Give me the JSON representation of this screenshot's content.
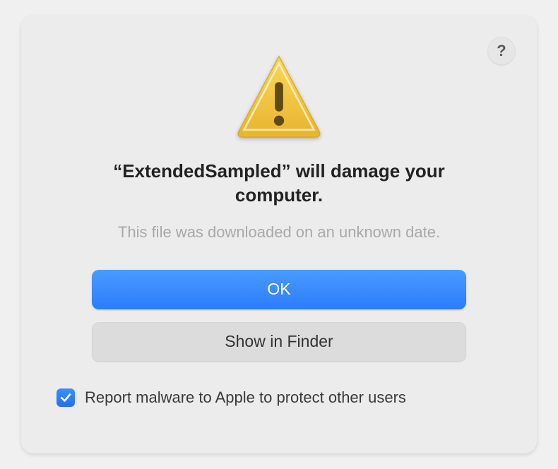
{
  "dialog": {
    "title": "“ExtendedSampled” will damage your computer.",
    "subtitle": "This file was downloaded on an unknown date.",
    "help_label": "?",
    "buttons": {
      "primary": "OK",
      "secondary": "Show in Finder"
    },
    "checkbox": {
      "checked": true,
      "label": "Report malware to Apple to protect other users"
    },
    "colors": {
      "accent": "#2c7cfd"
    }
  }
}
